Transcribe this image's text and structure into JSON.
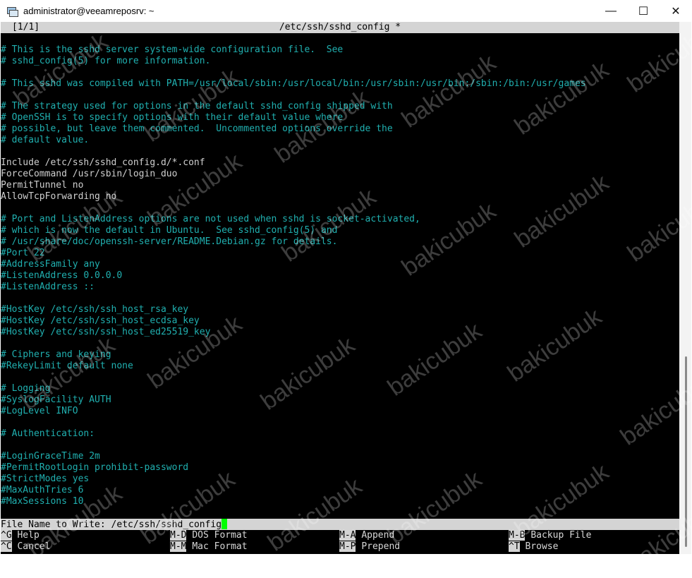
{
  "window": {
    "title": "administrator@veeamreposrv: ~",
    "minimize": "—",
    "maximize": "☐",
    "close": "✕"
  },
  "header": {
    "position": "[1/1]",
    "filename": "/etc/ssh/sshd_config *"
  },
  "lines": [
    {
      "text": "",
      "type": "dir"
    },
    {
      "text": "# This is the sshd server system-wide configuration file.  See",
      "type": "cmt"
    },
    {
      "text": "# sshd_config(5) for more information.",
      "type": "cmt"
    },
    {
      "text": "",
      "type": "dir"
    },
    {
      "text": "# This sshd was compiled with PATH=/usr/local/sbin:/usr/local/bin:/usr/sbin:/usr/bin:/sbin:/bin:/usr/games",
      "type": "cmt"
    },
    {
      "text": "",
      "type": "dir"
    },
    {
      "text": "# The strategy used for options in the default sshd_config shipped with",
      "type": "cmt"
    },
    {
      "text": "# OpenSSH is to specify options with their default value where",
      "type": "cmt"
    },
    {
      "text": "# possible, but leave them commented.  Uncommented options override the",
      "type": "cmt"
    },
    {
      "text": "# default value.",
      "type": "cmt"
    },
    {
      "text": "",
      "type": "dir"
    },
    {
      "text": "Include /etc/ssh/sshd_config.d/*.conf",
      "type": "dir"
    },
    {
      "text": "ForceCommand /usr/sbin/login_duo",
      "type": "dir"
    },
    {
      "text": "PermitTunnel no",
      "type": "dir"
    },
    {
      "text": "AllowTcpForwarding no",
      "type": "dir"
    },
    {
      "text": "",
      "type": "dir"
    },
    {
      "text": "# Port and ListenAddress options are not used when sshd is socket-activated,",
      "type": "cmt"
    },
    {
      "text": "# which is now the default in Ubuntu.  See sshd_config(5) and",
      "type": "cmt"
    },
    {
      "text": "# /usr/share/doc/openssh-server/README.Debian.gz for details.",
      "type": "cmt"
    },
    {
      "text": "#Port 22",
      "type": "cmt"
    },
    {
      "text": "#AddressFamily any",
      "type": "cmt"
    },
    {
      "text": "#ListenAddress 0.0.0.0",
      "type": "cmt"
    },
    {
      "text": "#ListenAddress ::",
      "type": "cmt"
    },
    {
      "text": "",
      "type": "dir"
    },
    {
      "text": "#HostKey /etc/ssh/ssh_host_rsa_key",
      "type": "cmt"
    },
    {
      "text": "#HostKey /etc/ssh/ssh_host_ecdsa_key",
      "type": "cmt"
    },
    {
      "text": "#HostKey /etc/ssh/ssh_host_ed25519_key",
      "type": "cmt"
    },
    {
      "text": "",
      "type": "dir"
    },
    {
      "text": "# Ciphers and keying",
      "type": "cmt"
    },
    {
      "text": "#RekeyLimit default none",
      "type": "cmt"
    },
    {
      "text": "",
      "type": "dir"
    },
    {
      "text": "# Logging",
      "type": "cmt"
    },
    {
      "text": "#SyslogFacility AUTH",
      "type": "cmt"
    },
    {
      "text": "#LogLevel INFO",
      "type": "cmt"
    },
    {
      "text": "",
      "type": "dir"
    },
    {
      "text": "# Authentication:",
      "type": "cmt"
    },
    {
      "text": "",
      "type": "dir"
    },
    {
      "text": "#LoginGraceTime 2m",
      "type": "cmt"
    },
    {
      "text": "#PermitRootLogin prohibit-password",
      "type": "cmt"
    },
    {
      "text": "#StrictModes yes",
      "type": "cmt"
    },
    {
      "text": "#MaxAuthTries 6",
      "type": "cmt"
    },
    {
      "text": "#MaxSessions 10",
      "type": "cmt"
    },
    {
      "text": "",
      "type": "dir"
    }
  ],
  "prompt": {
    "label": "File Name to Write: ",
    "value": "/etc/ssh/sshd_config"
  },
  "help": [
    [
      {
        "key": "^G",
        "desc": "Help"
      },
      {
        "key": "M-D",
        "desc": "DOS Format"
      },
      {
        "key": "M-A",
        "desc": "Append"
      },
      {
        "key": "M-B",
        "desc": "Backup File"
      }
    ],
    [
      {
        "key": "^C",
        "desc": "Cancel"
      },
      {
        "key": "M-M",
        "desc": "Mac Format"
      },
      {
        "key": "M-P",
        "desc": "Prepend"
      },
      {
        "key": "^T",
        "desc": "Browse"
      }
    ]
  ],
  "watermark": "bakicubuk",
  "colors": {
    "comment": "#20b0b0",
    "text": "#cfcfcf",
    "cursor": "#00ff00",
    "bar": "#d4d4d4"
  }
}
